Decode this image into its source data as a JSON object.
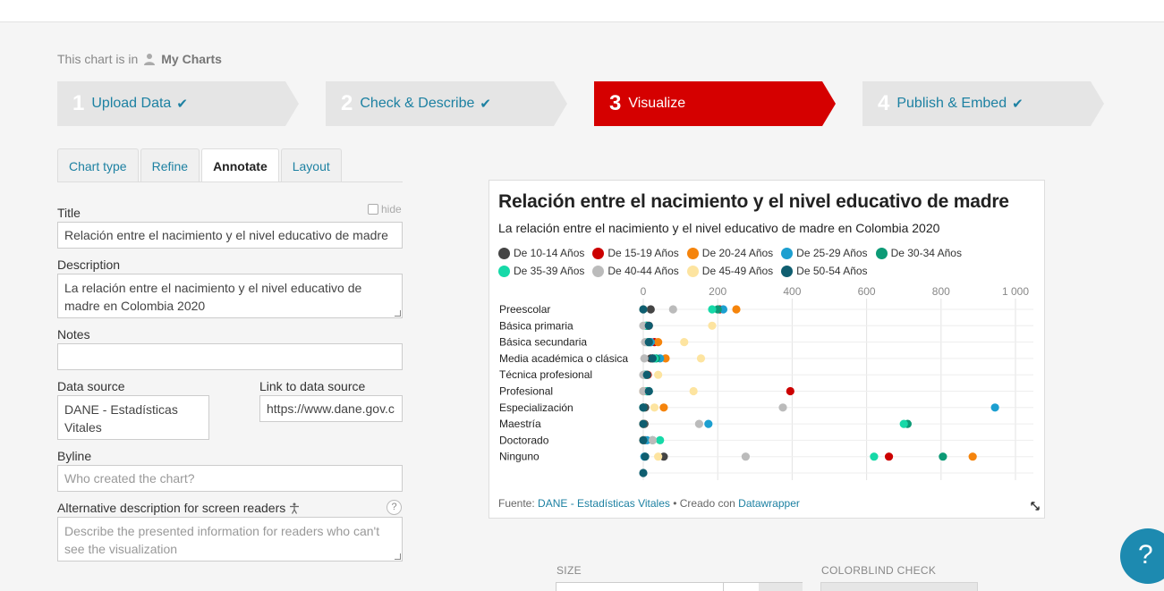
{
  "header": {
    "chart_in_prefix": "This chart is in",
    "chart_in_folder": "My Charts"
  },
  "steps": [
    {
      "num": "1",
      "label": "Upload Data",
      "done": "✔"
    },
    {
      "num": "2",
      "label": "Check & Describe",
      "done": "✔"
    },
    {
      "num": "3",
      "label": "Visualize",
      "done": ""
    },
    {
      "num": "4",
      "label": "Publish & Embed",
      "done": "✔"
    }
  ],
  "tabs": [
    "Chart type",
    "Refine",
    "Annotate",
    "Layout"
  ],
  "form": {
    "title_label": "Title",
    "hide_label": "hide",
    "title_value": "Relación entre el nacimiento y el nivel educativo de madre",
    "description_label": "Description",
    "description_value": "La relación entre el nacimiento y el nivel educativo de madre en Colombia 2020",
    "notes_label": "Notes",
    "notes_value": "",
    "source_label": "Data source",
    "source_value": "DANE - Estadísticas Vitales",
    "link_label": "Link to data source",
    "link_value": "https://www.dane.gov.c",
    "byline_label": "Byline",
    "byline_placeholder": "Who created the chart?",
    "alt_label": "Alternative description for screen readers",
    "alt_help": "?",
    "alt_placeholder": "Describe the presented information for readers who can't see the visualization"
  },
  "bottom": {
    "size_label": "SIZE",
    "colorblind_label": "COLORBLIND CHECK",
    "help_button": "?"
  },
  "chart_data": {
    "type": "scatter",
    "title": "Relación entre el nacimiento y el nivel educativo de madre",
    "subtitle": "La relación entre el nacimiento y el nivel educativo de madre en Colombia 2020",
    "xlim": [
      0,
      1000
    ],
    "xticks": [
      "0",
      "200",
      "400",
      "600",
      "800",
      "1 000"
    ],
    "grid": true,
    "legend_position": "top",
    "categories": [
      "Preescolar",
      "Básica primaria",
      "Básica secundaria",
      "Media académica o clásica",
      "Técnica profesional",
      "Profesional",
      "Especialización",
      "Maestría",
      "Doctorado",
      "Ninguno",
      ""
    ],
    "series": [
      {
        "name": "De 10-14 Años",
        "color": "#444444",
        "values": [
          20,
          10,
          20,
          20,
          10,
          10,
          5,
          3,
          5,
          55,
          null
        ]
      },
      {
        "name": "De 15-19 Años",
        "color": "#cc0000",
        "values": [
          205,
          15,
          30,
          25,
          12,
          395,
          0,
          0,
          0,
          660,
          null
        ]
      },
      {
        "name": "De 20-24 Años",
        "color": "#f5840c",
        "values": [
          250,
          12,
          40,
          60,
          10,
          0,
          55,
          0,
          0,
          885,
          null
        ]
      },
      {
        "name": "De 25-29 Años",
        "color": "#1c9fd0",
        "values": [
          215,
          10,
          20,
          45,
          8,
          10,
          945,
          175,
          10,
          3,
          null
        ]
      },
      {
        "name": "De 30-34 Años",
        "color": "#0c9a76",
        "values": [
          200,
          8,
          15,
          35,
          5,
          15,
          0,
          710,
          25,
          805,
          null
        ]
      },
      {
        "name": "De 35-39 Años",
        "color": "#16d9a8",
        "values": [
          185,
          5,
          10,
          30,
          3,
          10,
          0,
          700,
          45,
          620,
          null
        ]
      },
      {
        "name": "De 40-44 Años",
        "color": "#bbbbbb",
        "values": [
          80,
          0,
          5,
          3,
          0,
          0,
          375,
          150,
          25,
          275,
          null
        ]
      },
      {
        "name": "De 45-49 Años",
        "color": "#fde4a0",
        "values": [
          0,
          185,
          110,
          155,
          40,
          135,
          30,
          0,
          0,
          40,
          null
        ]
      },
      {
        "name": "De 50-54 Años",
        "color": "#0f5e70",
        "values": [
          0,
          15,
          15,
          25,
          10,
          15,
          0,
          0,
          0,
          5,
          0
        ]
      }
    ],
    "footer_prefix": "Fuente:",
    "footer_source": "DANE - Estadísticas Vitales",
    "footer_mid": "• Creado con",
    "footer_tool": "Datawrapper"
  }
}
